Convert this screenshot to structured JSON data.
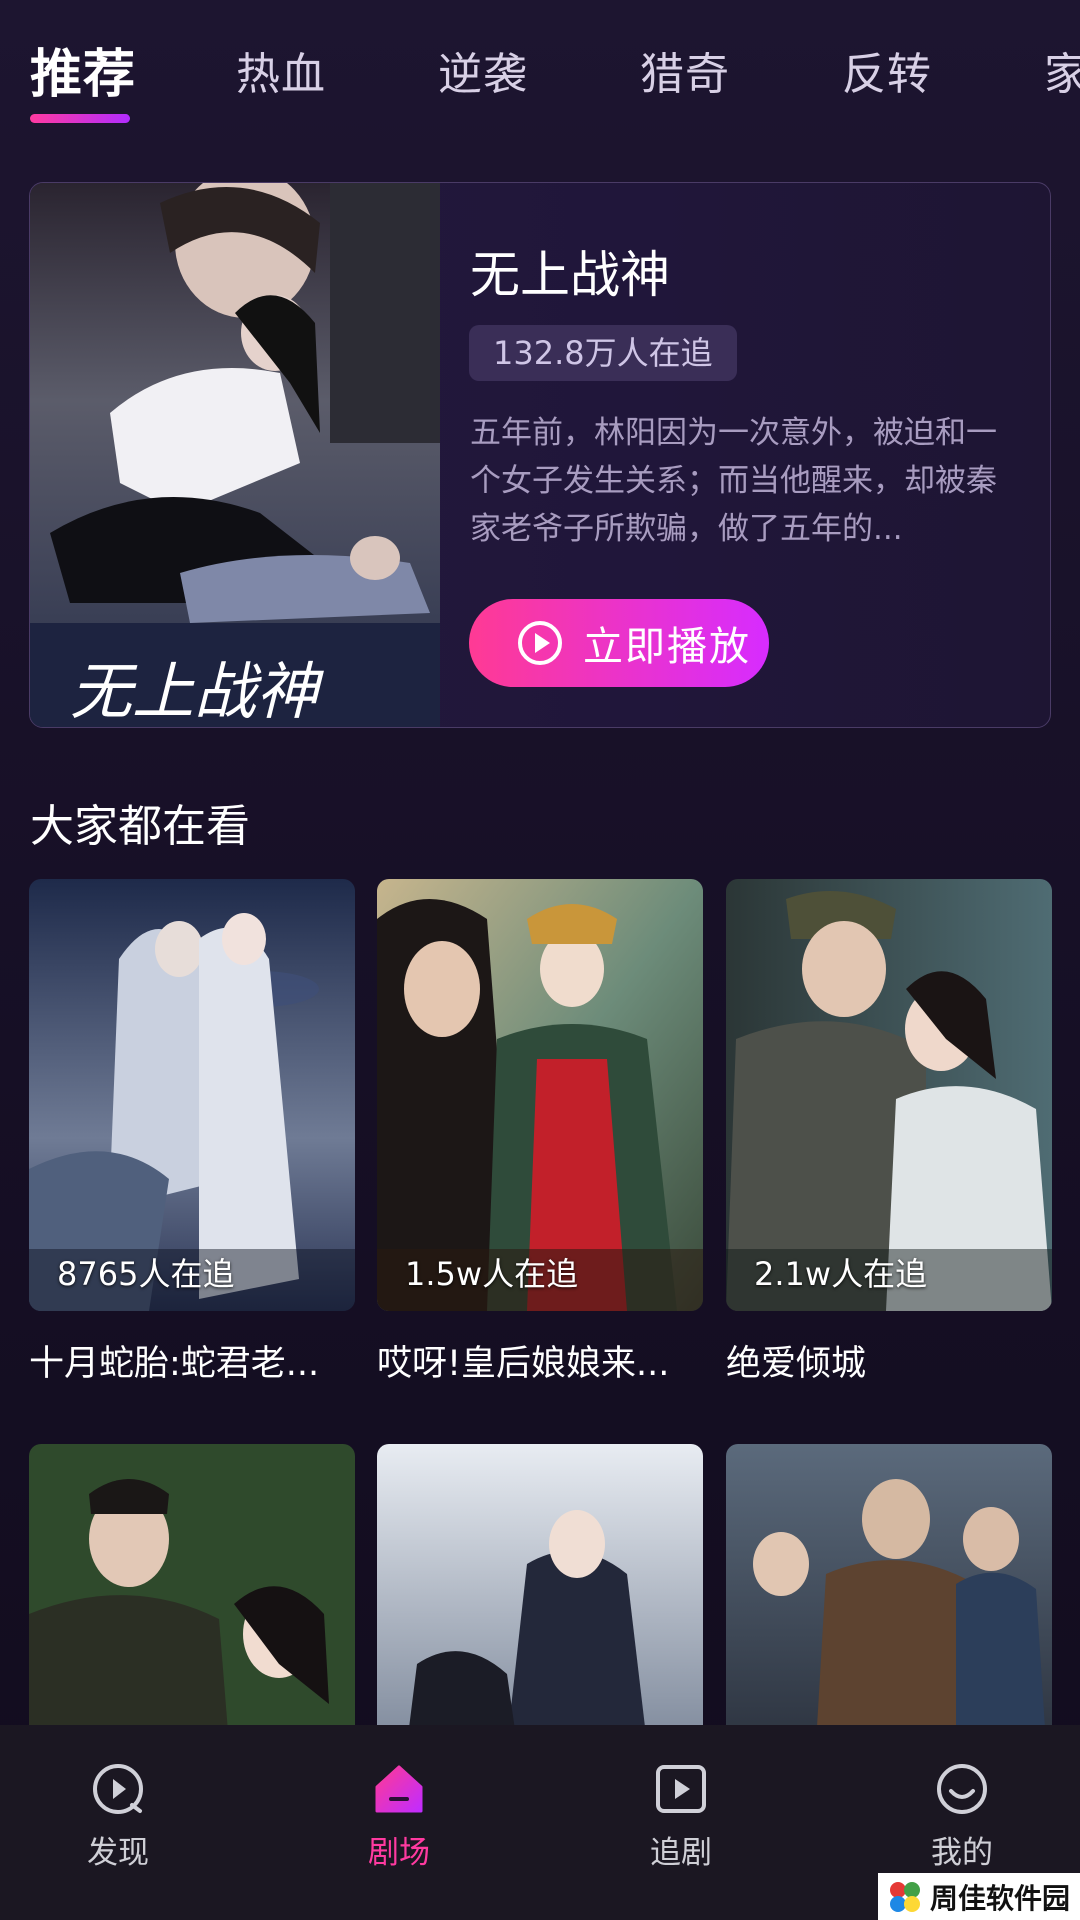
{
  "tabs": [
    "推荐",
    "热血",
    "逆袭",
    "猎奇",
    "反转",
    "家"
  ],
  "featured": {
    "title": "无上战神",
    "followers": "132.8万人在追",
    "description": "五年前，林阳因为一次意外，被迫和一个女子发生关系；而当他醒来，却被秦家老爷子所欺骗，做了五年的...",
    "play_label": "立即播放",
    "poster_text": "无上战神"
  },
  "section_title": "大家都在看",
  "grid": [
    {
      "count": "8765人在追",
      "title": "十月蛇胎:蛇君老..."
    },
    {
      "count": "1.5w人在追",
      "title": "哎呀!皇后娘娘来..."
    },
    {
      "count": "2.1w人在追",
      "title": "绝爱倾城"
    },
    {
      "count": "",
      "title": ""
    },
    {
      "count": "",
      "title": ""
    },
    {
      "count": "",
      "title": ""
    }
  ],
  "nav": [
    {
      "label": "发现",
      "icon": "discover-icon"
    },
    {
      "label": "剧场",
      "icon": "theater-home-icon"
    },
    {
      "label": "追剧",
      "icon": "follow-play-icon"
    },
    {
      "label": "我的",
      "icon": "profile-smile-icon"
    }
  ],
  "colors": {
    "accent": "#ff3aa0",
    "accent2": "#c12cff",
    "background": "#1d1530"
  },
  "watermark": "周佳软件园"
}
